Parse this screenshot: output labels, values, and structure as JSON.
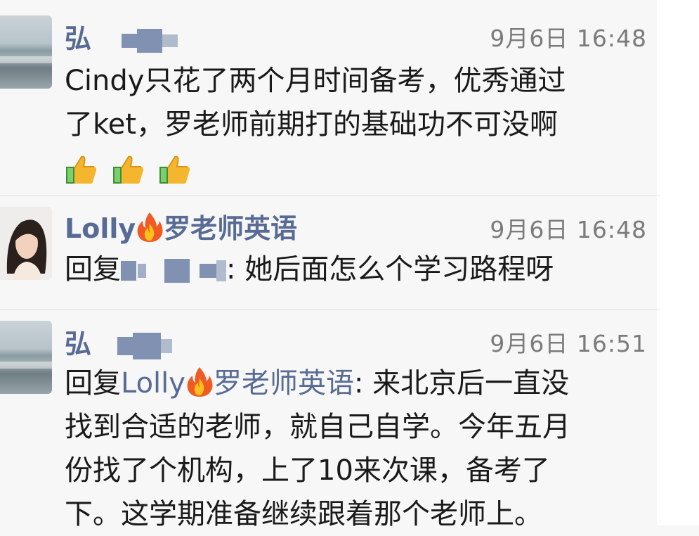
{
  "comments": [
    {
      "author": "弘",
      "time": "9月6日 16:48",
      "text_lines": [
        "Cindy只花了两个月时间备考，优秀通过",
        "了ket，罗老师前期打的基础功不可没啊"
      ],
      "reaction_icons": [
        "thumbs-up-icon",
        "thumbs-up-icon",
        "thumbs-up-icon"
      ]
    },
    {
      "author_part1": "Lolly",
      "author_part2": "罗老师英语",
      "time": "9月6日 16:48",
      "reply_prefix": "回复",
      "reply_text": ": 她后面怎么个学习路程呀"
    },
    {
      "author": "弘",
      "time": "9月6日 16:51",
      "reply_prefix": "回复",
      "reply_to_part1": "Lolly",
      "reply_to_part2": "罗老师英语",
      "lines": [
        "来北京后一直没",
        "找到合适的老师，就自己自学。今年五月",
        "份找了个机构，上了10来次课，备考了",
        "下。这学期准备继续跟着那个老师上。"
      ]
    }
  ],
  "colors": {
    "link": "#576b95",
    "time": "#7b7b7b",
    "text": "#1a1a1a",
    "background": "#f7f7f7"
  }
}
